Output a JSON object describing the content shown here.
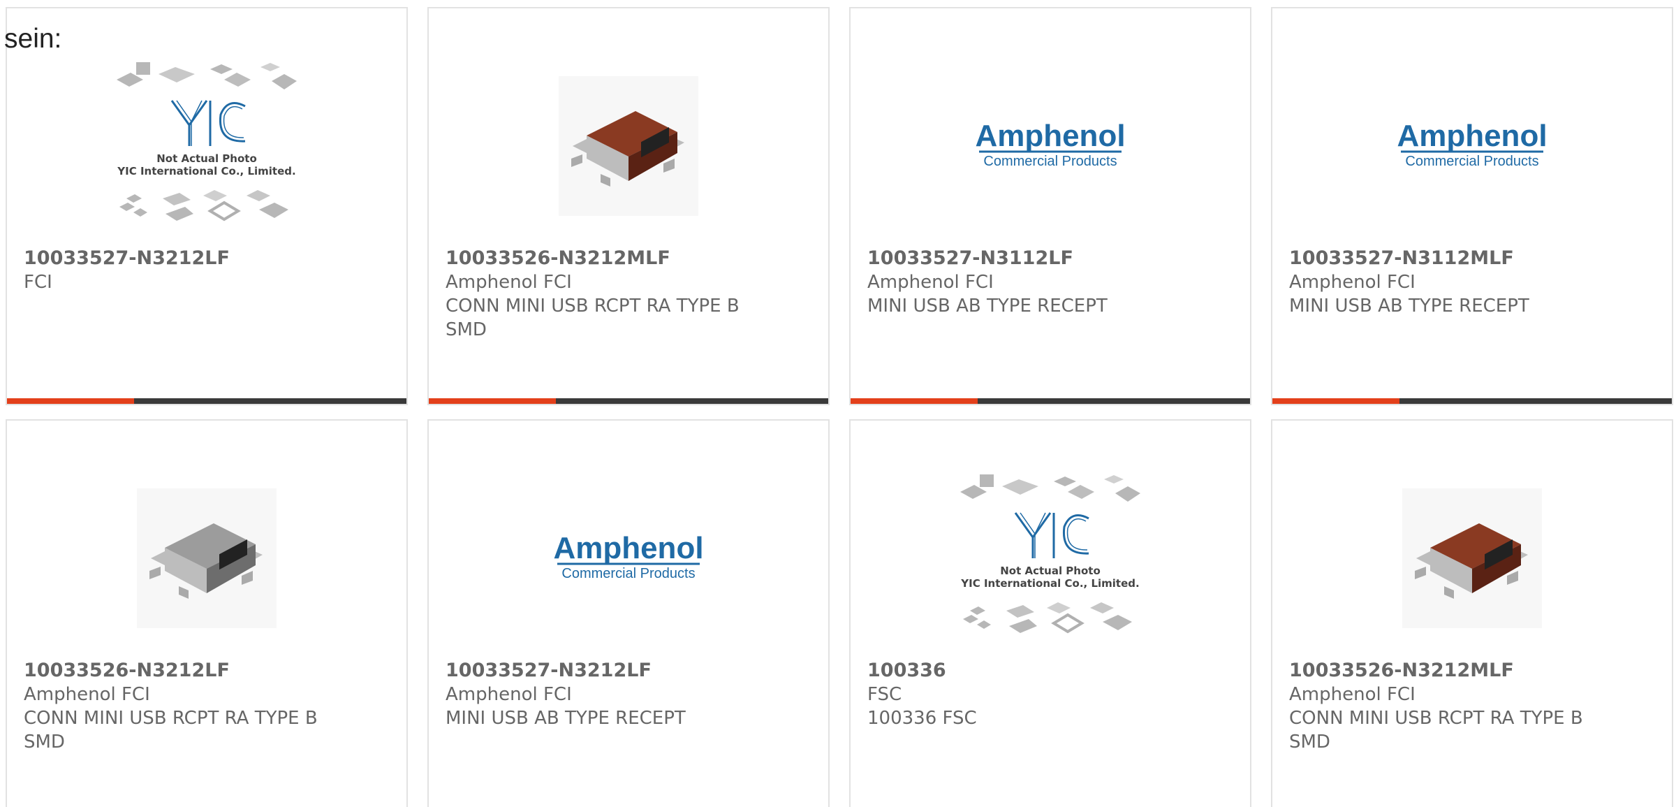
{
  "overlay": {
    "text": "sein:"
  },
  "cards": [
    {
      "part": "10033527-N3212LF",
      "maker": "FCI",
      "desc": "",
      "image": "yic-placeholder"
    },
    {
      "part": "10033526-N3212MLF",
      "maker": "Amphenol FCI",
      "desc": "CONN MINI USB RCPT RA TYPE B SMD",
      "image": "usb-connector-red"
    },
    {
      "part": "10033527-N3112LF",
      "maker": "Amphenol FCI",
      "desc": "MINI USB AB TYPE RECEPT",
      "image": "amphenol-logo"
    },
    {
      "part": "10033527-N3112MLF",
      "maker": "Amphenol FCI",
      "desc": "MINI USB AB TYPE RECEPT",
      "image": "amphenol-logo"
    },
    {
      "part": "10033526-N3212LF",
      "maker": "Amphenol FCI",
      "desc": "CONN MINI USB RCPT RA TYPE B SMD",
      "image": "usb-connector-silver"
    },
    {
      "part": "10033527-N3212LF",
      "maker": "Amphenol FCI",
      "desc": "MINI USB AB TYPE RECEPT",
      "image": "amphenol-logo"
    },
    {
      "part": "100336",
      "maker": "FSC",
      "desc": "100336 FSC",
      "image": "yic-placeholder"
    },
    {
      "part": "10033526-N3212MLF",
      "maker": "Amphenol FCI",
      "desc": "CONN MINI USB RCPT RA TYPE B SMD",
      "image": "usb-connector-red"
    }
  ],
  "logos": {
    "amphenol_name": "Amphenol",
    "amphenol_sub": "Commercial Products",
    "yic_line1": "Not Actual Photo",
    "yic_line2": "YIC International Co., Limited."
  },
  "colors": {
    "accent": "#e3401b",
    "bar": "#3a3a3a",
    "text": "#666666",
    "amphenol_blue": "#1f6aa5"
  }
}
